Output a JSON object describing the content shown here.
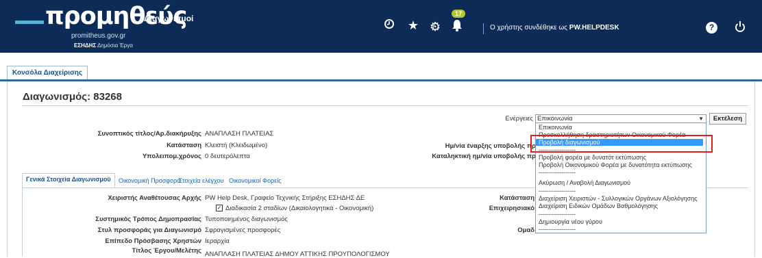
{
  "header": {
    "logo_word": "προμηθεύς",
    "logo_subtitle": "Διαγωνισμοί",
    "logo_url": "promitheus.gov.gr",
    "logo_org": "ΕΣΗΔΗΣ",
    "logo_org_sub": "Δημόσια Έργα",
    "notification_count": "17",
    "user_prefix": "Ο χρήστης συνδέθηκε ως",
    "user_name": "PW.HELPDESK",
    "help_glyph": "?",
    "icons": [
      "home-icon",
      "clock-icon",
      "star-icon",
      "gear-icon",
      "bell-icon",
      "help-icon",
      "power-icon"
    ]
  },
  "tabs": {
    "console": "Κονσόλα Διαχείρισης"
  },
  "page": {
    "title": "Διαγωνισμός: 83268"
  },
  "actions": {
    "label": "Ενέργειες",
    "selected": "Επικοινωνία",
    "execute": "Εκτέλεση",
    "options": [
      "Επικοινωνία",
      "Προσκολλήθηση δραστηριοτήτων Οικονομικού Φορέα",
      "Προβολή διαγωνισμού",
      "------------------",
      "Προβολή φορέα με δυνατότ εκτύπωσης",
      "Προβολή Οικονομικού Φορέα με δυνατότητα εκτύπωσης",
      "------------------",
      "Ακύρωση / Αναβολή Διαγωνισμού",
      "------------------",
      "Διαχείριση Χειριστών - Συλλογικών Οργάνων Αξιολόγησης",
      "Διαχείριση Ειδικών Ομάδων Βαθμολόγησης",
      "------------------",
      "Δημιουργία νέου γύρου",
      "------------------"
    ],
    "selected_option_index": 2
  },
  "summary": {
    "title_label": "Συνοπτικός τίτλος/Αρ.διακήρυξης",
    "title_value": "ΑΝΑΠΛΑΣΗ ΠΛΑΤΕΙΑΣ",
    "status_label": "Κατάσταση",
    "status_value": "Κλειστή (Κλειδωμένο)",
    "remaining_label": "Υπολειπομ.χρόνος",
    "remaining_value": "0 δευτερόλεπτα",
    "start_date_label": "Ημ/νία έναρξης υποβολής πρ",
    "end_date_label": "Καταληκτική ημ/νία υποβολής πρ"
  },
  "subtabs": [
    "Γενικά Στοιχεία Διαγωνισμού",
    "Οικονομική Προσφορά",
    "Στοιχεία ελέγχου",
    "Οικονομικοί Φορείς"
  ],
  "general": {
    "authority_label": "Χειριστής Αναθέτουσας Αρχής",
    "authority_value": "PW Help Desk, Γραφείο Τεχνικής Στήριξης ΕΣΗΔΗΣ ΔΕ",
    "two_stage_value": "Διαδικασία 2 σταδίων (Δικαιολογητικά - Οικονομική)",
    "two_stage_checked": true,
    "method_label": "Συστημικός Τρόπος Δημοπρασίας",
    "method_value": "Τυποποιημένος διαγωνισμός",
    "offer_style_label": "Στυλ προσφοράς για Διαγωνισμό",
    "offer_style_value": "Σφραγισμένες προσφορές",
    "access_label": "Επίπεδο Πρόσβασης Χρηστών",
    "access_value": "Ιεραρχία",
    "project_title_label": "Τίτλος Έργου/Μελέτης",
    "project_title_value": "ΑΝΑΠΛΑΣΗ ΠΛΑΤΕΙΑΣ ΔΗΜΟΥ ΑΤΤΙΚΗΣ ΠΡΟΥΠΟΛΟΓΙΣΜΟΥ",
    "right_status_label": "Κατάσταση",
    "right_business_label": "Επιχειρησιακό",
    "right_group_label": "Ομαδ"
  }
}
